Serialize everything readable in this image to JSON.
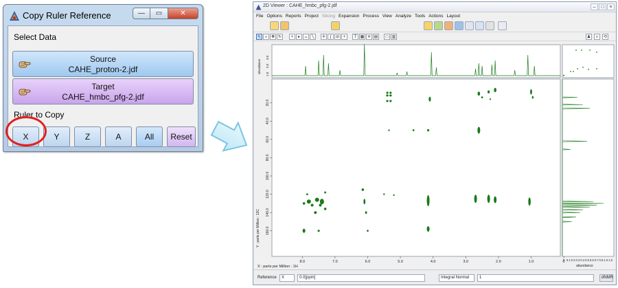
{
  "dialog": {
    "title": "Copy Ruler Reference",
    "select_data_label": "Select Data",
    "source_label": "Source",
    "source_file": "CAHE_proton-2.jdf",
    "target_label": "Target",
    "target_file": "CAHE_hmbc_pfg-2.jdf",
    "ruler_label": "Ruler to Copy",
    "ruler_buttons": [
      "X",
      "Y",
      "Z",
      "A",
      "All",
      "Reset"
    ],
    "highlighted_button": "X",
    "highlight_color": "#e02020"
  },
  "viewer": {
    "title": "2D Viewer : CAHE_hmbc_pfg-2.jdf",
    "menu": [
      "File",
      "Options",
      "Reports",
      "Project",
      "Slicing",
      "Expansion",
      "Process",
      "View",
      "Analyze",
      "Tools",
      "Actions",
      "Layout"
    ],
    "disabled_menu": [
      "Slicing"
    ],
    "x_axis_label": "X : parts per Million : 1H",
    "y_axis_label": "Y : parts per Million : 13C",
    "top_axis_label": "abundance",
    "right_axis_label": "abundance",
    "x_ticks": [
      "8.0",
      "7.0",
      "6.0",
      "5.0",
      "4.0",
      "3.0",
      "2.0",
      "1.0",
      "0"
    ],
    "y_ticks": [
      "20.0",
      "40.0",
      "60.0",
      "80.0",
      "100.0",
      "120.0",
      "140.0",
      "160.0"
    ],
    "top_ticks": [
      "1.0",
      "2.0",
      "3.0"
    ],
    "right_ticks": [
      "0",
      "0.1",
      "0.2",
      "0.3",
      "0.4",
      "0.5",
      "0.6",
      "0.7",
      "0.8",
      "1.0",
      "1.5"
    ],
    "status": {
      "reference_label": "Reference",
      "axis_select": "X",
      "value": "0.0[ppm]",
      "mode": "Integral Normal",
      "mode_value": "1",
      "unit_button": "dNMR"
    },
    "peak_color": "#1a7a1a"
  }
}
